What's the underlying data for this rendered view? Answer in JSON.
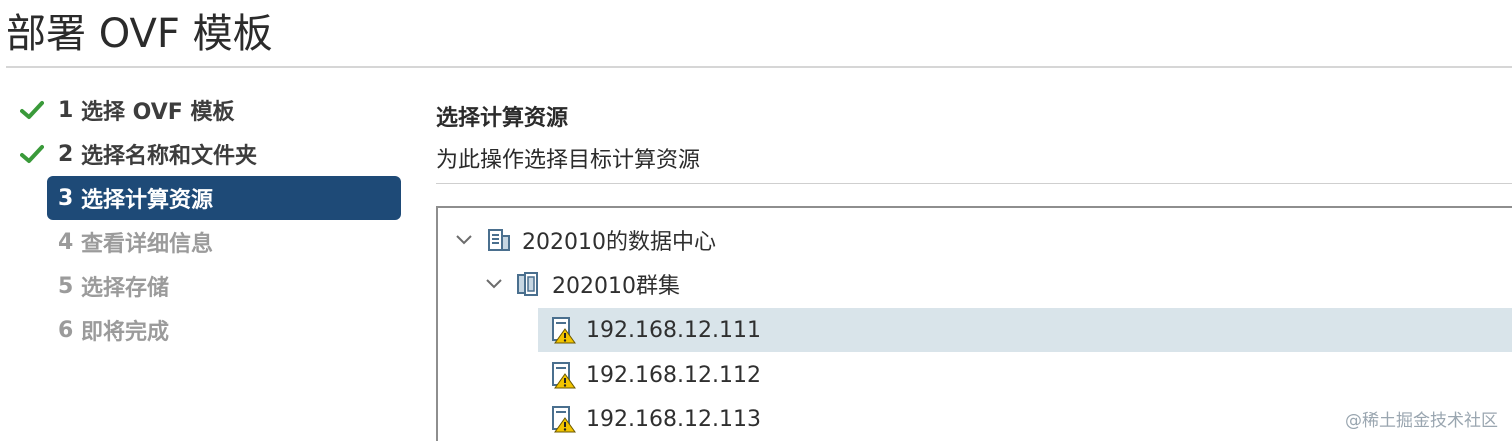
{
  "window": {
    "title": "部署 OVF 模板"
  },
  "steps": [
    {
      "number": "1",
      "label": "选择 OVF 模板",
      "state": "done"
    },
    {
      "number": "2",
      "label": "选择名称和文件夹",
      "state": "done"
    },
    {
      "number": "3",
      "label": "选择计算资源",
      "state": "active"
    },
    {
      "number": "4",
      "label": "查看详细信息",
      "state": "pending"
    },
    {
      "number": "5",
      "label": "选择存储",
      "state": "pending"
    },
    {
      "number": "6",
      "label": "即将完成",
      "state": "pending"
    }
  ],
  "content": {
    "title": "选择计算资源",
    "subtitle": "为此操作选择目标计算资源"
  },
  "tree": {
    "datacenter": {
      "label": "202010的数据中心",
      "icon": "datacenter-icon",
      "expanded": true
    },
    "cluster": {
      "label": "202010群集",
      "icon": "cluster-icon",
      "expanded": true
    },
    "hosts": [
      {
        "label": "192.168.12.111",
        "icon": "host-warning-icon",
        "selected": true
      },
      {
        "label": "192.168.12.112",
        "icon": "host-warning-icon",
        "selected": false
      },
      {
        "label": "192.168.12.113",
        "icon": "host-warning-icon",
        "selected": false
      }
    ]
  },
  "watermark": "@稀土掘金技术社区",
  "colors": {
    "active_step_bg": "#1e4a77",
    "check_green": "#3a9a3a",
    "selected_row_bg": "#d9e4ea",
    "warning_yellow": "#f2c400"
  }
}
